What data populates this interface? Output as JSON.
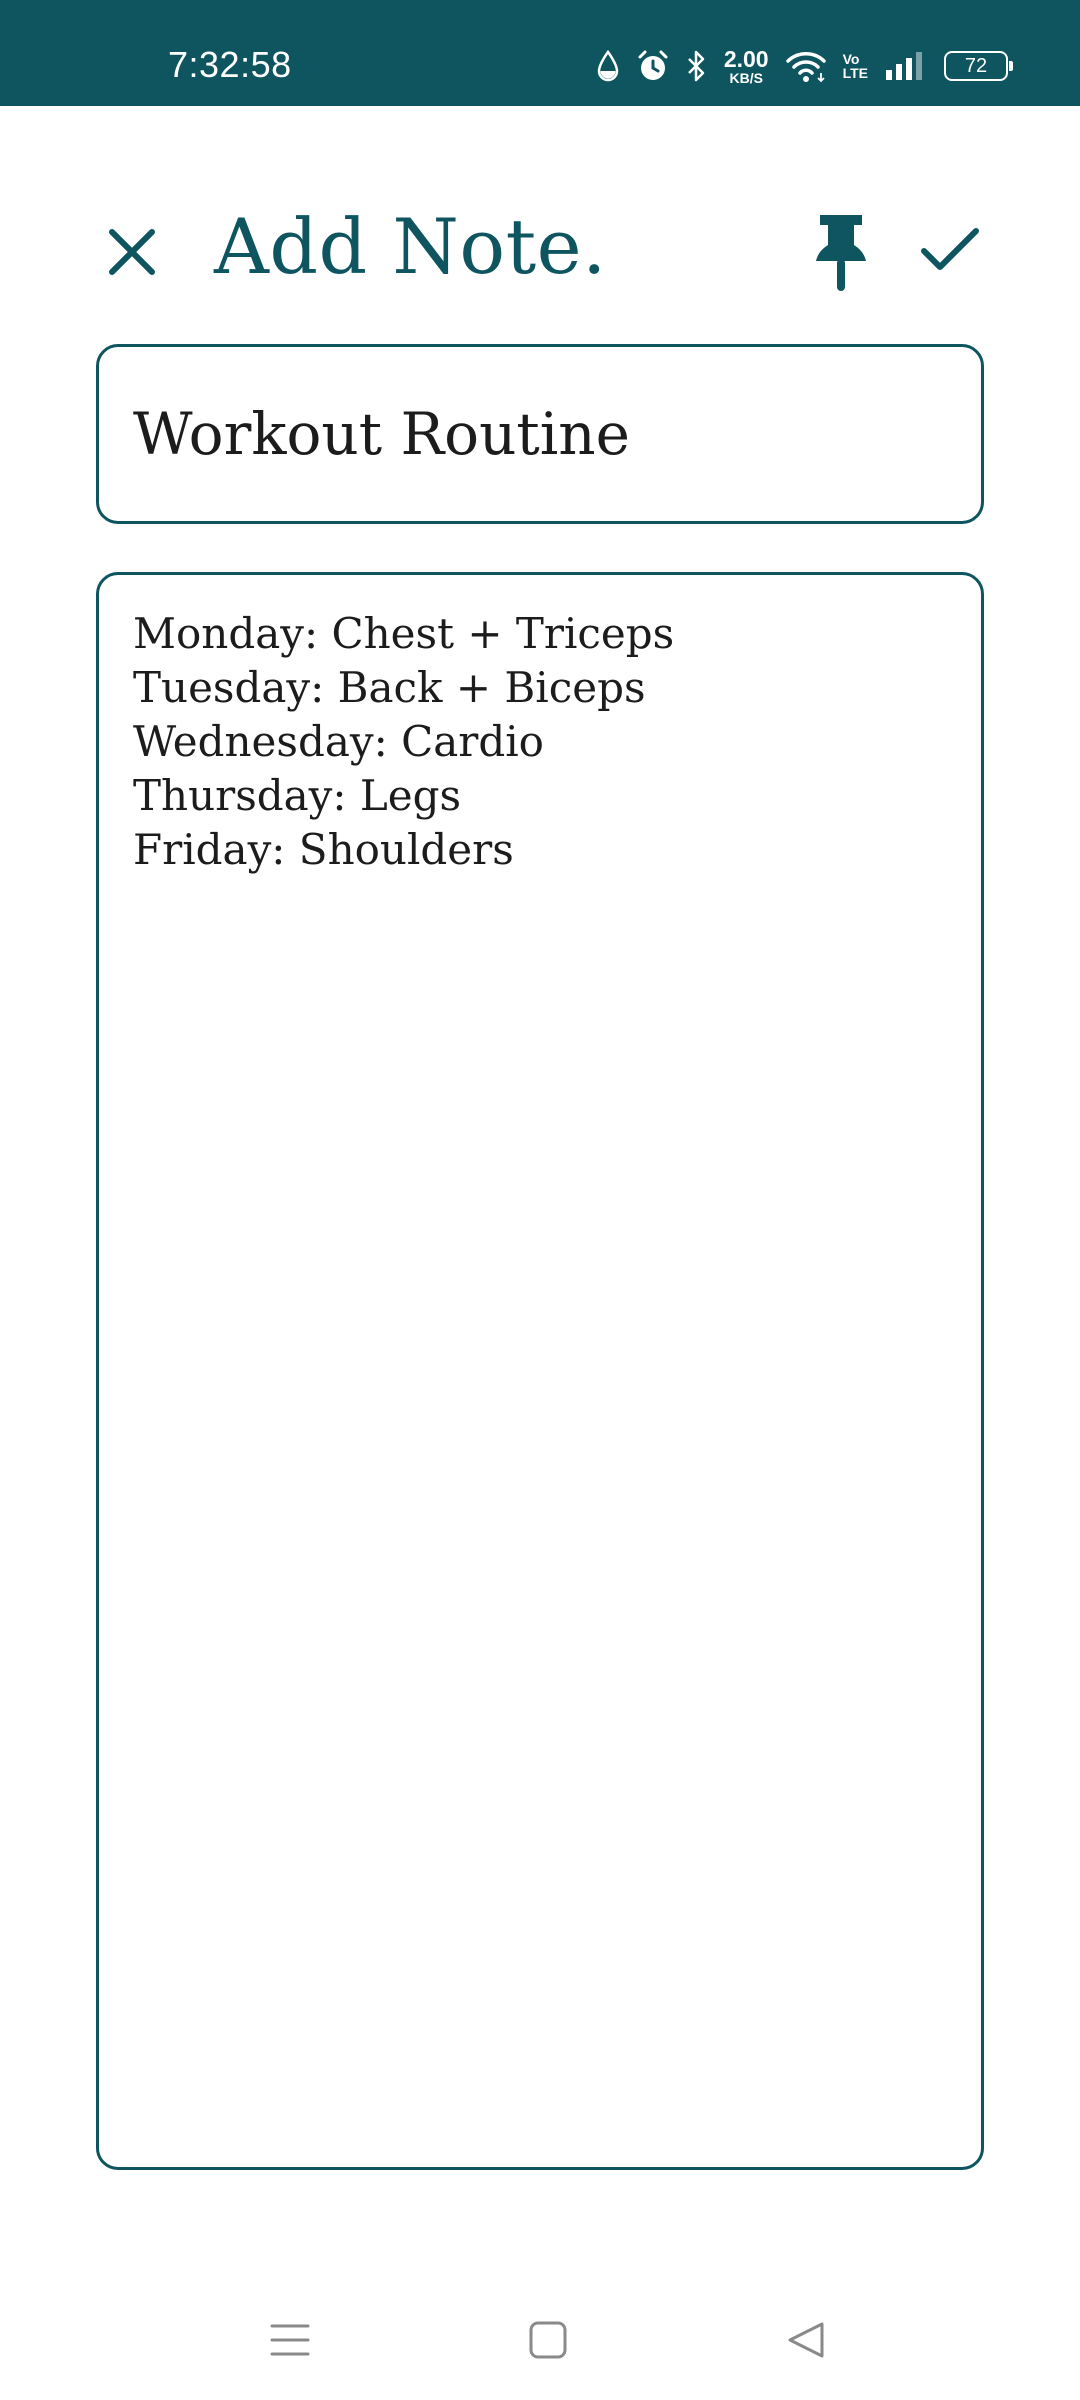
{
  "status_bar": {
    "time": "7:32:58",
    "net_speed_value": "2.00",
    "net_speed_unit": "KB/S",
    "volte_top": "Vo",
    "volte_bottom": "LTE",
    "battery_level": "72",
    "icons": [
      "water-drop-icon",
      "alarm-icon",
      "bluetooth-icon",
      "wifi-icon",
      "signal-icon",
      "battery-icon"
    ],
    "background_color": "#0e5560"
  },
  "header": {
    "title": "Add Note.",
    "close_icon": "close-icon",
    "pin_icon": "pin-icon",
    "save_icon": "check-icon"
  },
  "note": {
    "title_value": "Workout Routine",
    "body_value": "Monday: Chest + Triceps\nTuesday: Back + Biceps\nWednesday: Cardio\nThursday: Legs\nFriday: Shoulders"
  },
  "nav_bar": {
    "icons": [
      "menu-icon",
      "home-icon",
      "back-icon"
    ]
  },
  "colors": {
    "accent": "#0e5560",
    "text": "#1c1c1c",
    "background": "#ffffff"
  }
}
